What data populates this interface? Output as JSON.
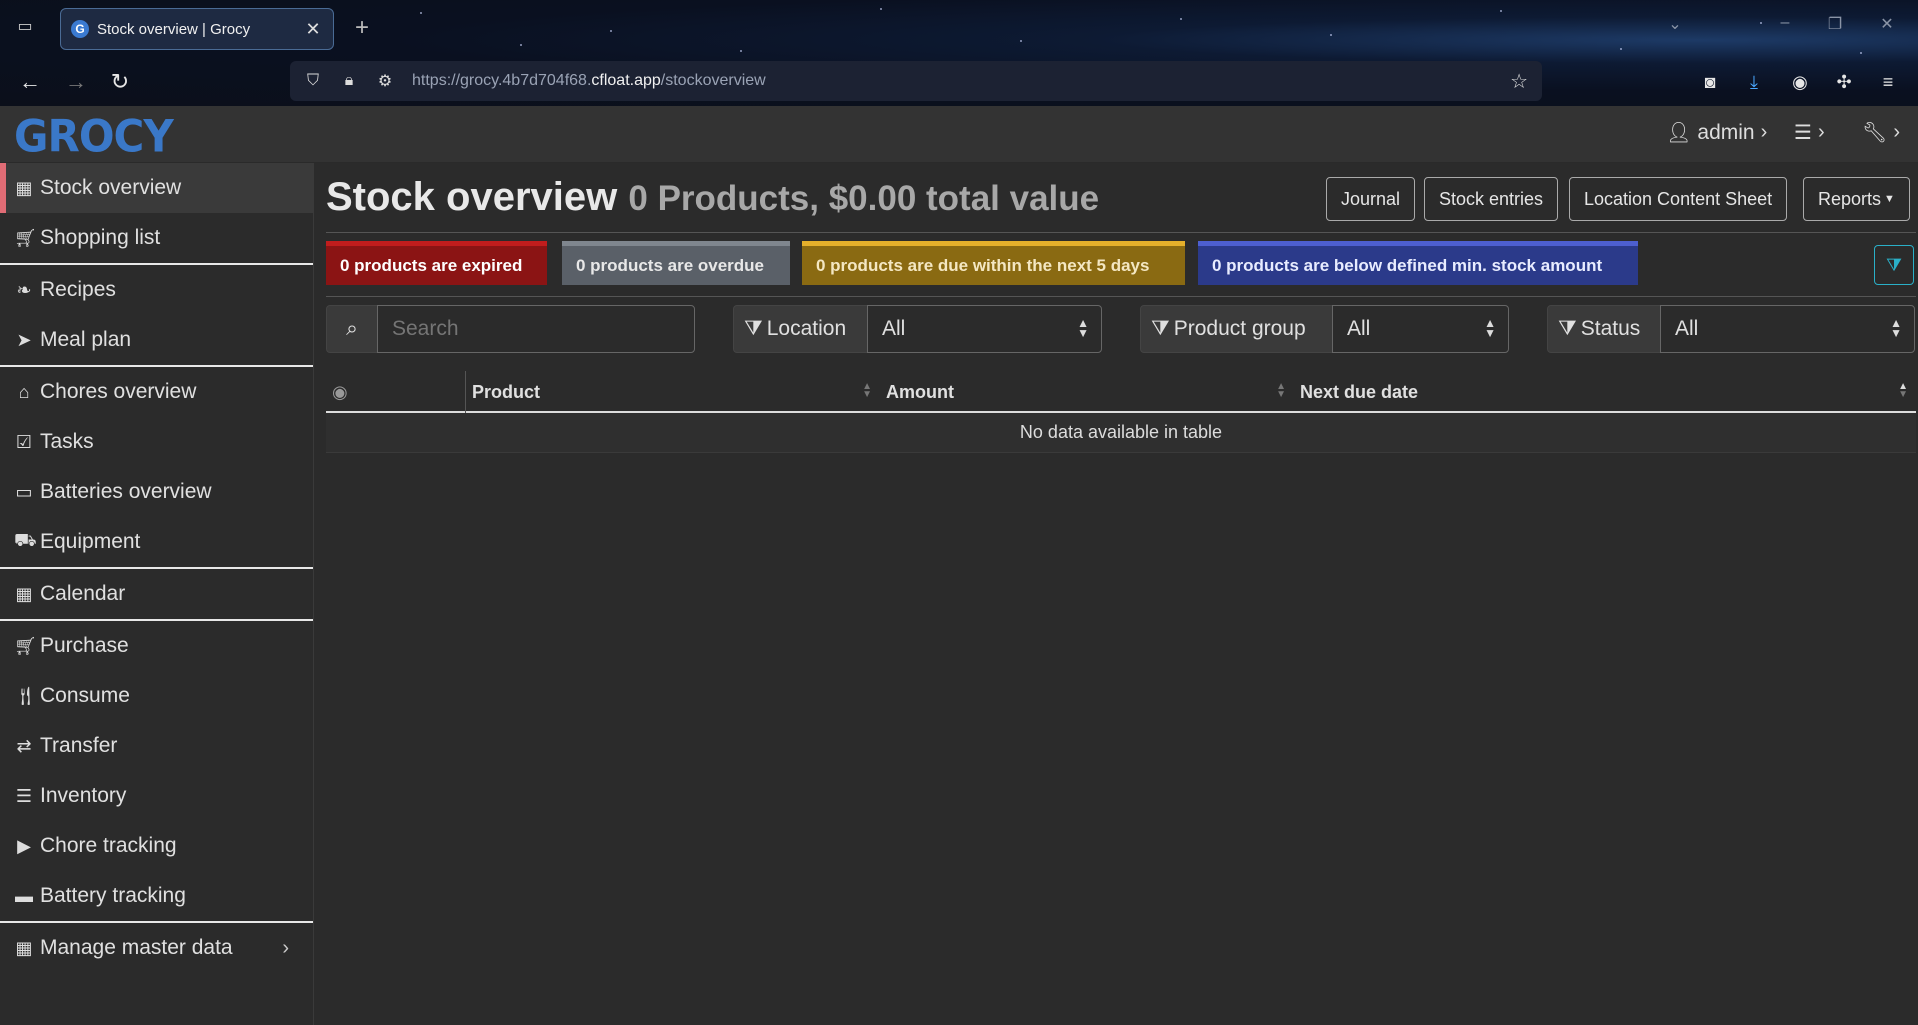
{
  "browser": {
    "tab_title": "Stock overview | Grocy",
    "favicon_letter": "G",
    "url_prefix": "https://grocy.4b7d704f68.",
    "url_domain": "cfloat.app",
    "url_path": "/stockoverview"
  },
  "header": {
    "logo": "GROCY",
    "user_label": "admin"
  },
  "sidebar": {
    "items": [
      {
        "label": "Stock overview",
        "icon": "box-icon"
      },
      {
        "label": "Shopping list",
        "icon": "cart-icon"
      },
      {
        "label": "Recipes",
        "icon": "recipe-icon"
      },
      {
        "label": "Meal plan",
        "icon": "paper-plane-icon"
      },
      {
        "label": "Chores overview",
        "icon": "home-icon"
      },
      {
        "label": "Tasks",
        "icon": "tasks-icon"
      },
      {
        "label": "Batteries overview",
        "icon": "battery-icon"
      },
      {
        "label": "Equipment",
        "icon": "toolbox-icon"
      },
      {
        "label": "Calendar",
        "icon": "calendar-icon"
      },
      {
        "label": "Purchase",
        "icon": "cart-plus-icon"
      },
      {
        "label": "Consume",
        "icon": "utensils-icon"
      },
      {
        "label": "Transfer",
        "icon": "exchange-icon"
      },
      {
        "label": "Inventory",
        "icon": "list-icon"
      },
      {
        "label": "Chore tracking",
        "icon": "play-icon"
      },
      {
        "label": "Battery tracking",
        "icon": "car-battery-icon"
      },
      {
        "label": "Manage master data",
        "icon": "table-icon"
      }
    ]
  },
  "main": {
    "title": "Stock overview",
    "subtitle": "0 Products, $0.00 total value",
    "buttons": {
      "journal": "Journal",
      "stock_entries": "Stock entries",
      "location_sheet": "Location Content Sheet",
      "reports": "Reports"
    },
    "badges": {
      "expired": "0 products are expired",
      "overdue": "0 products are overdue",
      "due": "0 products are due within the next 5 days",
      "below": "0 products are below defined min. stock amount"
    },
    "filters": {
      "search_placeholder": "Search",
      "location_label": "Location",
      "location_value": "All",
      "product_group_label": "Product group",
      "product_group_value": "All",
      "status_label": "Status",
      "status_value": "All"
    },
    "table": {
      "columns": [
        "Product",
        "Amount",
        "Next due date"
      ],
      "empty_message": "No data available in table"
    }
  },
  "colors": {
    "active_accent": "#e06c75",
    "logo": "#3a78c8",
    "expired": "#8b1414",
    "overdue": "#5a6068",
    "due": "#8a6a12",
    "below": "#2b3a8a",
    "filter_toggle": "#2ab0c8"
  }
}
